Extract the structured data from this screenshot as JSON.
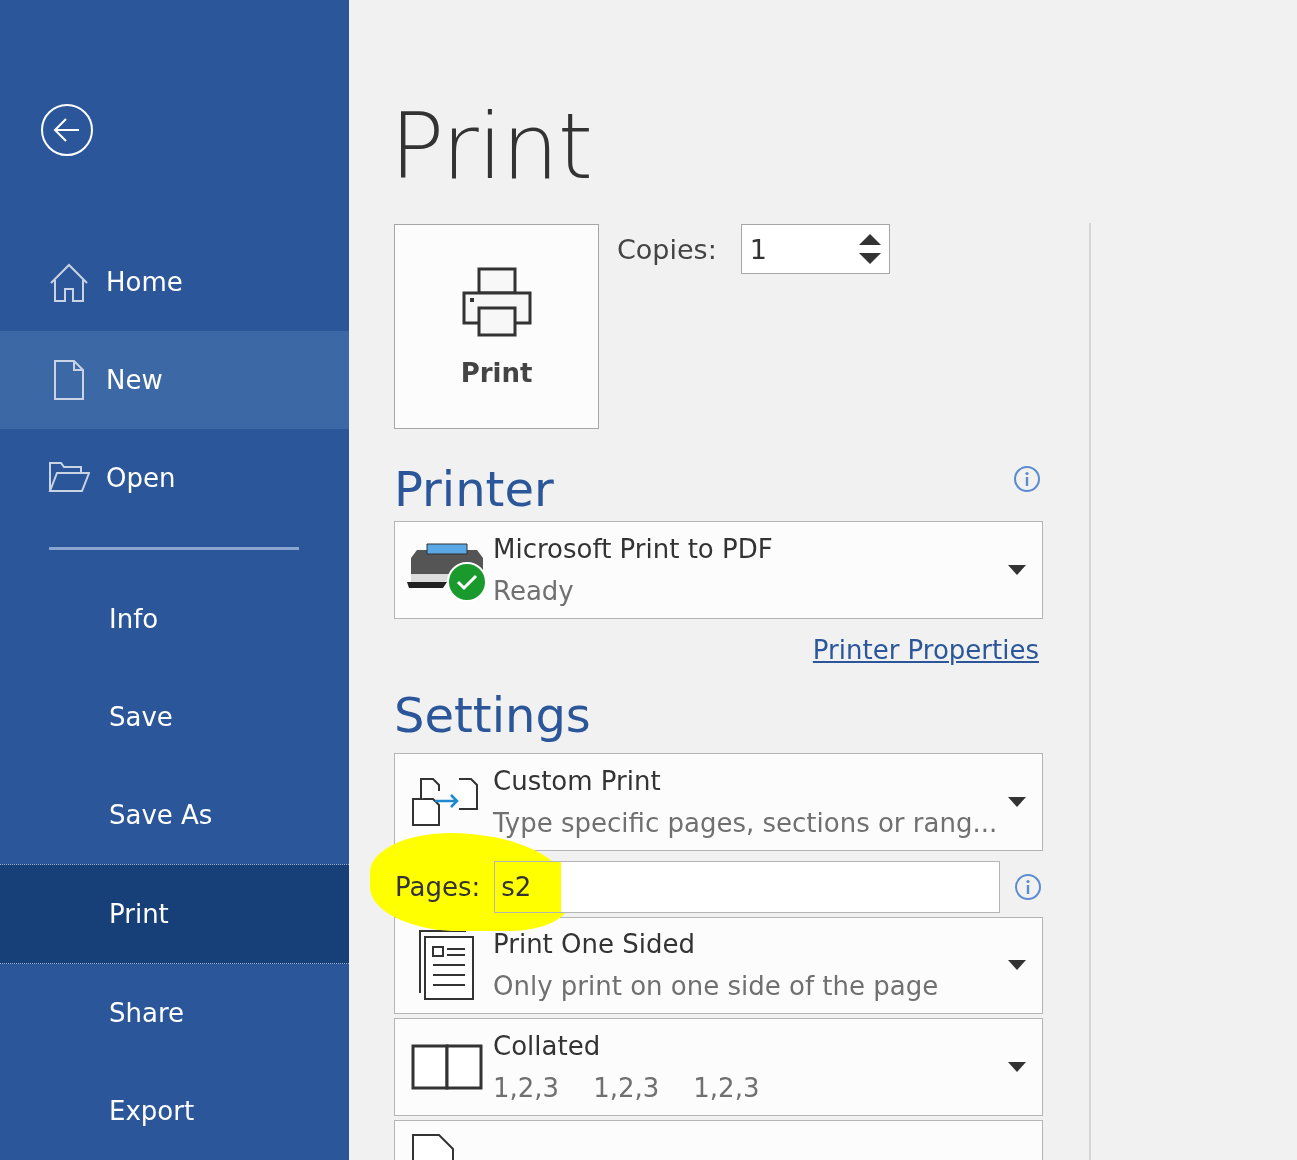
{
  "sidebar": {
    "items": [
      {
        "label": "Home",
        "kind": "home",
        "selected": false,
        "hovered": false
      },
      {
        "label": "New",
        "kind": "new",
        "selected": false,
        "hovered": true
      },
      {
        "label": "Open",
        "kind": "open",
        "selected": false,
        "hovered": false
      },
      {
        "kind": "divider"
      },
      {
        "label": "Info",
        "kind": "text",
        "selected": false,
        "hovered": false
      },
      {
        "label": "Save",
        "kind": "text",
        "selected": false,
        "hovered": false
      },
      {
        "label": "Save As",
        "kind": "text",
        "selected": false,
        "hovered": false
      },
      {
        "label": "Print",
        "kind": "text",
        "selected": true,
        "hovered": false
      },
      {
        "label": "Share",
        "kind": "text",
        "selected": false,
        "hovered": false
      },
      {
        "label": "Export",
        "kind": "text",
        "selected": false,
        "hovered": false
      }
    ]
  },
  "title": "Print",
  "print_button": {
    "label": "Print"
  },
  "copies": {
    "label": "Copies:",
    "value": "1"
  },
  "printer": {
    "heading": "Printer",
    "name": "Microsoft Print to PDF",
    "status": "Ready",
    "ready": true,
    "properties_link": "Printer Properties"
  },
  "settings": {
    "heading": "Settings",
    "items": [
      {
        "kind": "custom",
        "title": "Custom Print",
        "subtitle": "Type specific pages, sections or rang..."
      },
      {
        "kind": "pages",
        "label": "Pages:",
        "value": "s2",
        "highlighted": true
      },
      {
        "kind": "sided",
        "title": "Print One Sided",
        "subtitle": "Only print on one side of the page"
      },
      {
        "kind": "collated",
        "title": "Collated",
        "subtitle_parts": [
          "1,2,3",
          "1,2,3",
          "1,2,3"
        ]
      },
      {
        "kind": "orientation"
      }
    ]
  }
}
